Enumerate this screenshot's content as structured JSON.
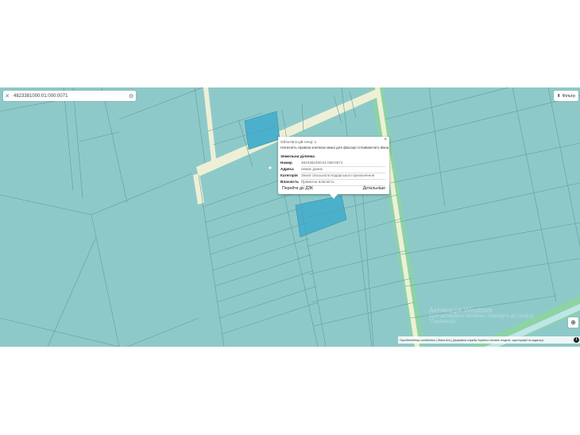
{
  "search": {
    "value": "4823381000:01:000:0071",
    "clear_icon": "close-icon",
    "locate_icon": "target-icon"
  },
  "filter": {
    "label": "Фільтр",
    "icon": "filter-icon"
  },
  "popup": {
    "objects_label": "Об'єктів в цій точці: 1",
    "hint": "Натисніть правою кнопкою миші для фіксації спливаючого вікна",
    "section_title": "Земельна ділянка",
    "rows": [
      {
        "key": "Номер",
        "value": "4823381000:01:000:0071"
      },
      {
        "key": "Адреса",
        "value": "немає даних"
      },
      {
        "key": "Категорія",
        "value": "Землі сільськогосподарського призначення"
      },
      {
        "key": "Власність",
        "value": "Приватна власність"
      }
    ],
    "button_dzk": "Перейти до ДЗК",
    "button_details": "Детальніше"
  },
  "watermark": {
    "line1": "Активація Windows",
    "line2": "Щоб активувати Windows, перейдіть до розділу \"Параметри\"."
  },
  "attribution": {
    "text": "OpenStreetMap contributors | Мапа Ans | Державна служба України з питань геодезії, картографії та кадастру"
  },
  "colors": {
    "parcel_fill": "#8ec9c9",
    "parcel_line": "#5e9da0",
    "selected_fill": "#4bb0cc",
    "road": "#eef0d6",
    "green_strip": "#8cd3a6"
  }
}
